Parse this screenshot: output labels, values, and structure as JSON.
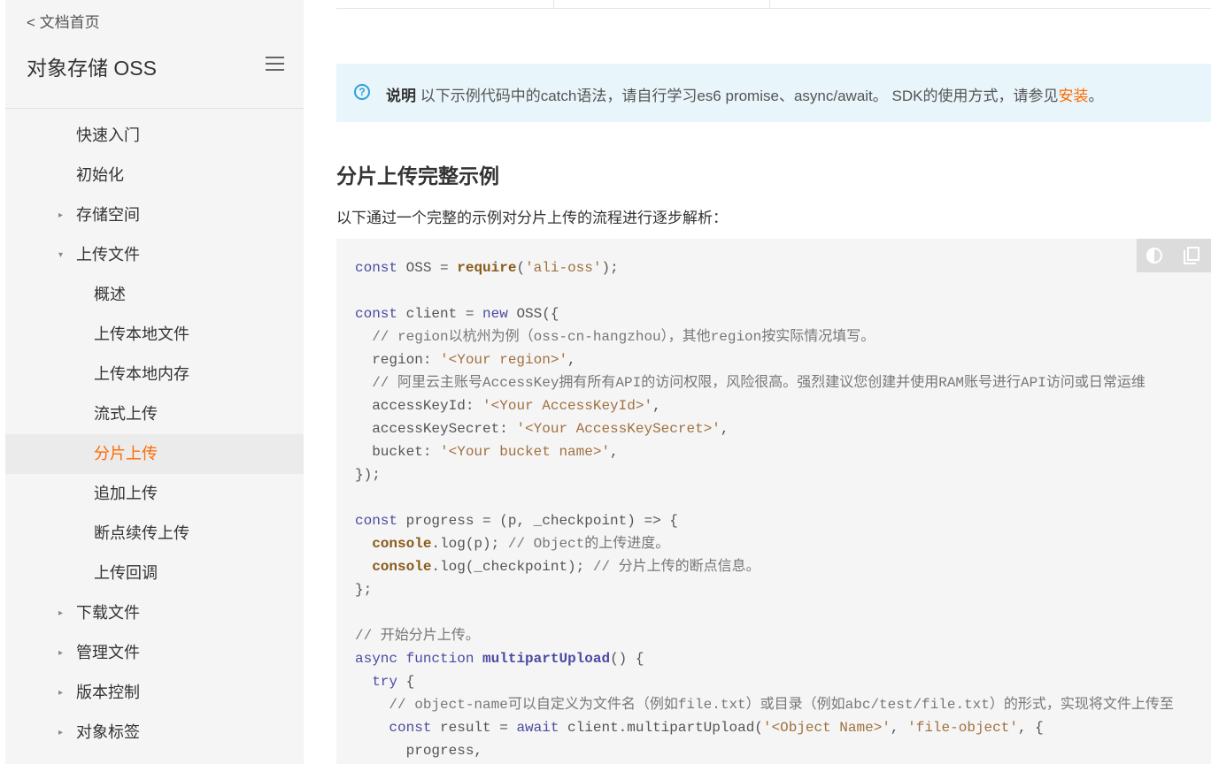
{
  "sidebar": {
    "back_link": "< 文档首页",
    "product_title": "对象存储 OSS",
    "items": [
      {
        "label": "快速入门",
        "level": 1,
        "caret": ""
      },
      {
        "label": "初始化",
        "level": 1,
        "caret": ""
      },
      {
        "label": "存储空间",
        "level": 1,
        "caret": "▸"
      },
      {
        "label": "上传文件",
        "level": 1,
        "caret": "▾"
      },
      {
        "label": "概述",
        "level": 2,
        "caret": ""
      },
      {
        "label": "上传本地文件",
        "level": 2,
        "caret": ""
      },
      {
        "label": "上传本地内存",
        "level": 2,
        "caret": ""
      },
      {
        "label": "流式上传",
        "level": 2,
        "caret": ""
      },
      {
        "label": "分片上传",
        "level": 2,
        "caret": "",
        "active": true
      },
      {
        "label": "追加上传",
        "level": 2,
        "caret": ""
      },
      {
        "label": "断点续传上传",
        "level": 2,
        "caret": ""
      },
      {
        "label": "上传回调",
        "level": 2,
        "caret": ""
      },
      {
        "label": "下载文件",
        "level": 1,
        "caret": "▸"
      },
      {
        "label": "管理文件",
        "level": 1,
        "caret": "▸"
      },
      {
        "label": "版本控制",
        "level": 1,
        "caret": "▸"
      },
      {
        "label": "对象标签",
        "level": 1,
        "caret": "▸"
      }
    ]
  },
  "note": {
    "icon": "question-circle-icon",
    "label": "说明",
    "text": " 以下示例代码中的catch语法，请自行学习es6 promise、async/await。 SDK的使用方式，请参见",
    "link": "安装",
    "suffix": "。"
  },
  "section": {
    "heading": "分片上传完整示例",
    "intro": "以下通过一个完整的示例对分片上传的流程进行逐步解析："
  },
  "code_toolbar": {
    "theme_icon": "theme-toggle-icon",
    "copy_icon": "copy-icon"
  },
  "code": {
    "lines": [
      [
        {
          "t": "const",
          "c": "kw"
        },
        {
          "t": " OSS = ",
          "c": ""
        },
        {
          "t": "require",
          "c": "fn"
        },
        {
          "t": "(",
          "c": ""
        },
        {
          "t": "'ali-oss'",
          "c": "str"
        },
        {
          "t": ");",
          "c": ""
        }
      ],
      [],
      [
        {
          "t": "const",
          "c": "kw"
        },
        {
          "t": " client = ",
          "c": ""
        },
        {
          "t": "new",
          "c": "kw"
        },
        {
          "t": " OSS({",
          "c": ""
        }
      ],
      [
        {
          "t": "  // region以杭州为例（oss-cn-hangzhou），其他region按实际情况填写。",
          "c": "com"
        }
      ],
      [
        {
          "t": "  region: ",
          "c": ""
        },
        {
          "t": "'<Your region>'",
          "c": "str"
        },
        {
          "t": ",",
          "c": ""
        }
      ],
      [
        {
          "t": "  // 阿里云主账号AccessKey拥有所有API的访问权限，风险很高。强烈建议您创建并使用RAM账号进行API访问或日常运维",
          "c": "com"
        }
      ],
      [
        {
          "t": "  accessKeyId: ",
          "c": ""
        },
        {
          "t": "'<Your AccessKeyId>'",
          "c": "str"
        },
        {
          "t": ",",
          "c": ""
        }
      ],
      [
        {
          "t": "  accessKeySecret: ",
          "c": ""
        },
        {
          "t": "'<Your AccessKeySecret>'",
          "c": "str"
        },
        {
          "t": ",",
          "c": ""
        }
      ],
      [
        {
          "t": "  bucket: ",
          "c": ""
        },
        {
          "t": "'<Your bucket name>'",
          "c": "str"
        },
        {
          "t": ",",
          "c": ""
        }
      ],
      [
        {
          "t": "});",
          "c": ""
        }
      ],
      [],
      [
        {
          "t": "const",
          "c": "kw"
        },
        {
          "t": " progress = (p, _checkpoint) => {",
          "c": ""
        }
      ],
      [
        {
          "t": "  ",
          "c": ""
        },
        {
          "t": "console",
          "c": "fn"
        },
        {
          "t": ".log(p); ",
          "c": ""
        },
        {
          "t": "// Object的上传进度。",
          "c": "com"
        }
      ],
      [
        {
          "t": "  ",
          "c": ""
        },
        {
          "t": "console",
          "c": "fn"
        },
        {
          "t": ".log(_checkpoint); ",
          "c": ""
        },
        {
          "t": "// 分片上传的断点信息。",
          "c": "com"
        }
      ],
      [
        {
          "t": "};",
          "c": ""
        }
      ],
      [],
      [
        {
          "t": "// 开始分片上传。",
          "c": "com"
        }
      ],
      [
        {
          "t": "async",
          "c": "kw"
        },
        {
          "t": " ",
          "c": ""
        },
        {
          "t": "function",
          "c": "kw"
        },
        {
          "t": " ",
          "c": ""
        },
        {
          "t": "multipartUpload",
          "c": "def"
        },
        {
          "t": "() {",
          "c": ""
        }
      ],
      [
        {
          "t": "  ",
          "c": ""
        },
        {
          "t": "try",
          "c": "kw"
        },
        {
          "t": " {",
          "c": ""
        }
      ],
      [
        {
          "t": "    // object-name可以自定义为文件名（例如file.txt）或目录（例如abc/test/file.txt）的形式，实现将文件上传至",
          "c": "com"
        }
      ],
      [
        {
          "t": "    ",
          "c": ""
        },
        {
          "t": "const",
          "c": "kw"
        },
        {
          "t": " result = ",
          "c": ""
        },
        {
          "t": "await",
          "c": "kw"
        },
        {
          "t": " client.multipartUpload(",
          "c": ""
        },
        {
          "t": "'<Object Name>'",
          "c": "str"
        },
        {
          "t": ", ",
          "c": ""
        },
        {
          "t": "'file-object'",
          "c": "str"
        },
        {
          "t": ", {",
          "c": ""
        }
      ],
      [
        {
          "t": "      progress,",
          "c": ""
        }
      ]
    ]
  }
}
